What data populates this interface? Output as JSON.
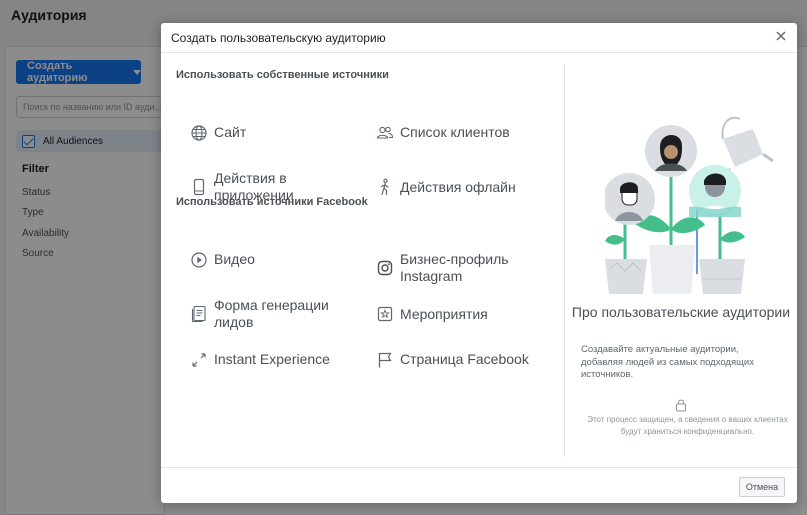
{
  "background": {
    "page_title": "Аудитория",
    "create_button_label": "Создать аудиторию",
    "search_placeholder": "Поиск по названию или ID ауди...",
    "all_audiences_label": "All Audiences",
    "filter_title": "Filter",
    "filter_items": [
      "Status",
      "Type",
      "Availability",
      "Source"
    ]
  },
  "modal": {
    "title": "Создать пользовательскую аудиторию",
    "section_own": "Использовать собственные источники",
    "section_facebook": "Использовать источники Facebook",
    "own_options": [
      {
        "label": "Сайт",
        "icon": "globe-icon"
      },
      {
        "label": "Список клиентов",
        "icon": "people-icon"
      },
      {
        "label": "Действия в приложении",
        "icon": "mobile-icon"
      },
      {
        "label": "Действия офлайн",
        "icon": "person-walking-icon"
      }
    ],
    "facebook_options": [
      {
        "label": "Видео",
        "icon": "play-icon"
      },
      {
        "label": "Бизнес-профиль Instagram",
        "icon": "instagram-icon"
      },
      {
        "label": "Форма генерации лидов",
        "icon": "form-icon"
      },
      {
        "label": "Мероприятия",
        "icon": "event-icon"
      },
      {
        "label": "Instant Experience",
        "icon": "expand-icon"
      },
      {
        "label": "Страница Facebook",
        "icon": "flag-icon"
      }
    ],
    "about_title": "Про пользовательские аудитории",
    "about_description": "Создавайте актуальные аудитории, добавляя людей из самых подходящих источников.",
    "secure_note": "Этот процесс защищен, а сведения о ваших клиентах будут храниться конфиденциально.",
    "cancel_label": "Отмена"
  },
  "colors": {
    "accent": "#1877f2",
    "text": "#4b4f56",
    "teal": "#7fd3c8",
    "plant_green": "#44bf8c"
  }
}
